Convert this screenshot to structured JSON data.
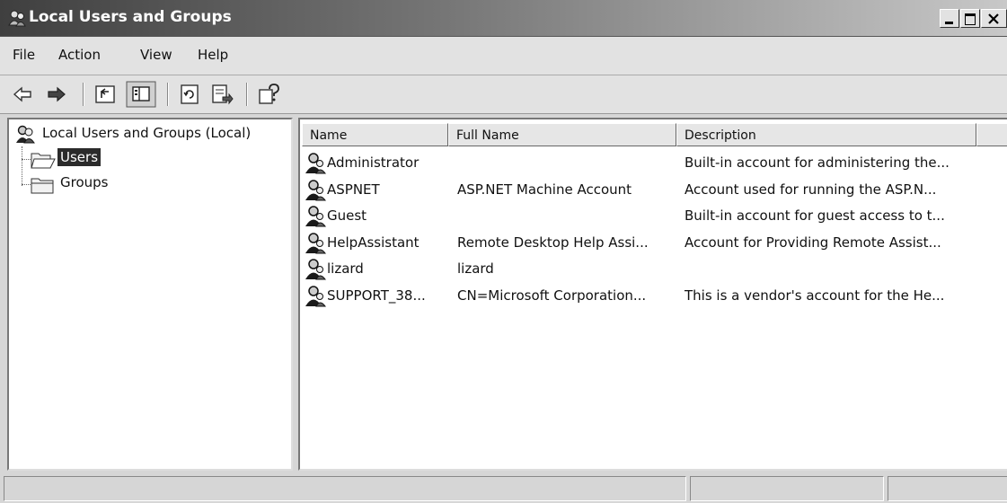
{
  "window": {
    "title": "Local Users and Groups",
    "title_icon": "users-and-groups-icon"
  },
  "menu": [
    "File",
    "Action",
    "View",
    "Help"
  ],
  "toolbar": {
    "buttons": [
      "back-arrow-icon",
      "forward-arrow-icon",
      "up-folder-icon",
      "show-hide-tree-icon",
      "refresh-icon",
      "export-list-icon",
      "help-icon"
    ]
  },
  "tree": {
    "root": "Local Users and Groups (Local)",
    "children": [
      "Users",
      "Groups"
    ],
    "selected": "Users"
  },
  "list": {
    "columns": [
      "Name",
      "Full Name",
      "Description"
    ],
    "rows": [
      {
        "name": "Administrator",
        "full_name": "",
        "description": "Built-in account for administering the..."
      },
      {
        "name": "ASPNET",
        "full_name": "ASP.NET Machine Account",
        "description": "Account used for running the ASP.N..."
      },
      {
        "name": "Guest",
        "full_name": "",
        "description": "Built-in account for guest access to t..."
      },
      {
        "name": "HelpAssistant",
        "full_name": "Remote Desktop Help Assi...",
        "description": "Account for Providing Remote Assist..."
      },
      {
        "name": "lizard",
        "full_name": "lizard",
        "description": ""
      },
      {
        "name": "SUPPORT_38...",
        "full_name": "CN=Microsoft Corporation...",
        "description": "This is a vendor's account for the He..."
      }
    ]
  },
  "colors": {
    "title_start": "#3f3f3f",
    "title_end": "#c8c8c8",
    "chrome": "#e2e2e2",
    "selection": "#2b2b2b"
  }
}
